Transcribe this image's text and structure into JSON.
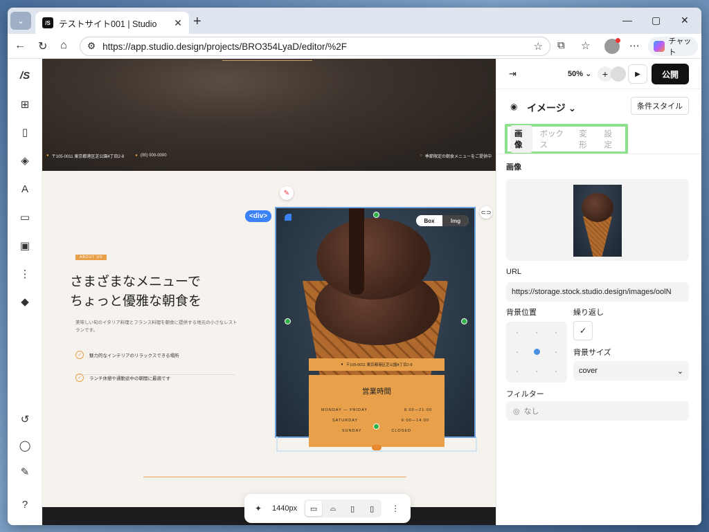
{
  "browser": {
    "tab_title": "テストサイト001 | Studio",
    "favicon_text": "/S",
    "url": "https://app.studio.design/projects/BRO354LyaD/editor/%2F",
    "chat_label": "チャット"
  },
  "canvas": {
    "hero_address": "〒105-0011 東京都港区芝公園4丁目2-8",
    "hero_phone": "(00) 000-0000",
    "hero_notice": "季節限定の朝食メニューをご提供中",
    "about_tag": "ABOUT US",
    "about_title": "さまざまなメニューで\nちょっと優雅な朝食を",
    "about_desc": "美味しい旬のイタリア料理とフランス料理を朝食に提供する地元の小さなレストランです。",
    "checks": [
      "魅力的なインテリアのリラックスできる場所",
      "ランチ休憩や通勤途中の朝間に最適です"
    ],
    "div_tag": "<div>",
    "toggle_box": "Box",
    "toggle_img": "Img",
    "card_address": "〒105-0011 東京都港区芝公園4丁目2-8",
    "hours_title": "営業時間",
    "hours": [
      {
        "day": "MONDAY — FRIDAY",
        "time": "8:00—21:00"
      },
      {
        "day": "SATURDAY",
        "time": "6:00—14:00"
      },
      {
        "day": "SUNDAY",
        "time": "CLOSED"
      }
    ]
  },
  "bottom_toolbar": {
    "width_label": "1440px"
  },
  "right_panel": {
    "zoom": "50%",
    "publish": "公開",
    "element_name": "イメージ",
    "condition_style": "条件スタイル",
    "tabs": [
      "画像",
      "ボックス",
      "変形",
      "設定"
    ],
    "section_image": "画像",
    "url_label": "URL",
    "url_value": "https://storage.stock.studio.design/images/oolN",
    "bg_position": "背景位置",
    "repeat": "繰り返し",
    "bg_size": "背景サイズ",
    "bg_size_value": "cover",
    "filter": "フィルター",
    "filter_value": "なし"
  },
  "colors": {
    "accent_orange": "#e8a04a",
    "selection_blue": "#3b82f6",
    "highlight_green": "#8de08c"
  }
}
